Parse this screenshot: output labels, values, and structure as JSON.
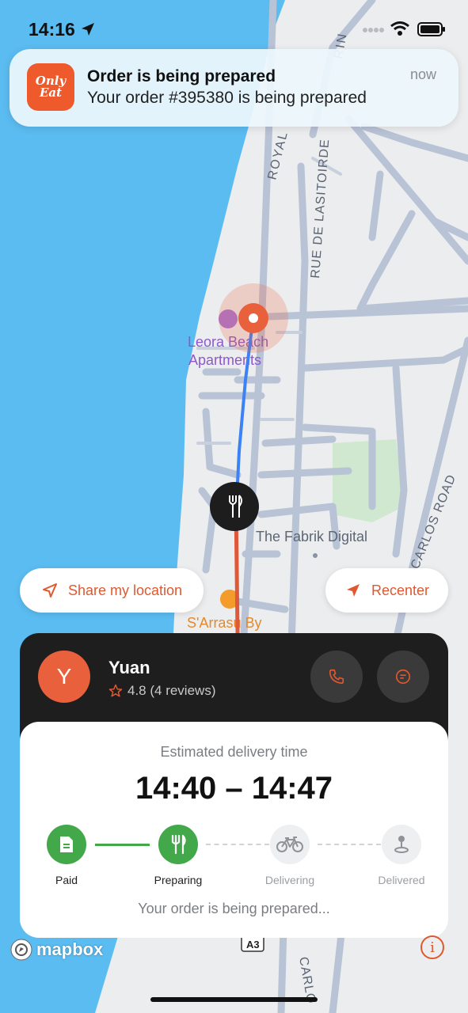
{
  "status_bar": {
    "time": "14:16"
  },
  "notification": {
    "app_icon_text": [
      "Only",
      "Eat"
    ],
    "title": "Order is being prepared",
    "body": "Your order #395380 is being prepared",
    "time": "now"
  },
  "map": {
    "labels": {
      "street_royal": "ROYAL",
      "street_rin": "RIN",
      "street_lasitoirde": "RUE DE LASITOIRDE",
      "poi_leora_1": "Leora Beach",
      "poi_leora_2": "Apartments",
      "poi_fabrik": "The Fabrik Digital",
      "street_carlos_road": "CARLOS ROAD",
      "poi_sarrasu": "S'Arrasu By",
      "road_a3": "A3",
      "street_carlo": "CARLO"
    }
  },
  "buttons": {
    "share_location": "Share my location",
    "recenter": "Recenter"
  },
  "courier": {
    "avatar_letter": "Y",
    "name": "Yuan",
    "rating": "4.8 (4 reviews)"
  },
  "delivery": {
    "eta_label": "Estimated delivery time",
    "eta": "14:40 – 14:47",
    "steps": [
      {
        "label": "Paid",
        "state": "done",
        "icon": "receipt-icon"
      },
      {
        "label": "Preparing",
        "state": "done",
        "icon": "utensils-icon"
      },
      {
        "label": "Delivering",
        "state": "pending",
        "icon": "bicycle-icon"
      },
      {
        "label": "Delivered",
        "state": "pending",
        "icon": "pin-icon"
      }
    ],
    "status_message": "Your order is being prepared..."
  },
  "footer": {
    "mapbox_label": "mapbox",
    "info_label": "i"
  },
  "colors": {
    "accent": "#e0582f",
    "success": "#43a84a",
    "water": "#5bbcf1",
    "route_blue": "#3b82f6",
    "route_red": "#e0583a"
  }
}
